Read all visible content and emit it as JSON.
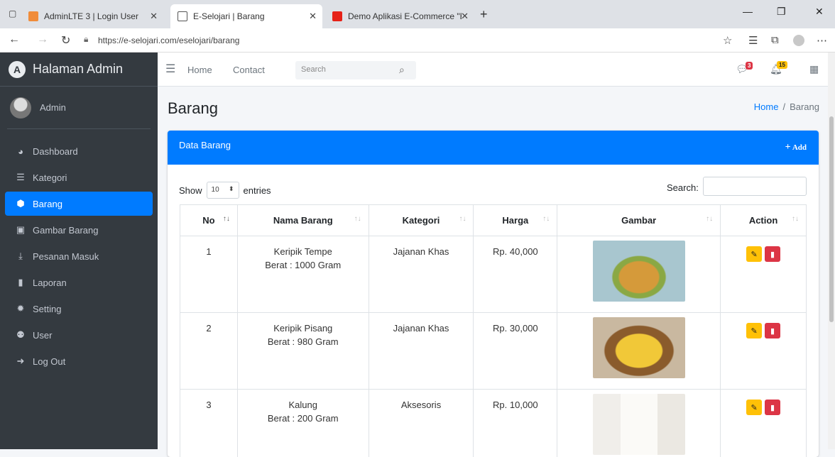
{
  "browser": {
    "tabs": [
      {
        "label": "AdminLTE 3 | Login User"
      },
      {
        "label": "E-Selojari | Barang"
      },
      {
        "label": "Demo Aplikasi E-Commerce \"E-S"
      }
    ],
    "url": "https://e-selojari.com/eselojari/barang"
  },
  "sidebar": {
    "brand": "Halaman Admin",
    "user": "Admin",
    "items": [
      {
        "label": "Dashboard",
        "icon": "dashboard-icon"
      },
      {
        "label": "Kategori",
        "icon": "list-icon"
      },
      {
        "label": "Barang",
        "icon": "cubes-icon",
        "active": true
      },
      {
        "label": "Gambar Barang",
        "icon": "image-icon"
      },
      {
        "label": "Pesanan Masuk",
        "icon": "download-icon"
      },
      {
        "label": "Laporan",
        "icon": "file-icon"
      },
      {
        "label": "Setting",
        "icon": "cog-icon"
      },
      {
        "label": "User",
        "icon": "users-icon"
      },
      {
        "label": "Log Out",
        "icon": "sign-out-icon"
      }
    ]
  },
  "navbar": {
    "home": "Home",
    "contact": "Contact",
    "search_placeholder": "Search",
    "messages_count": "3",
    "notifications_count": "15"
  },
  "page": {
    "title": "Barang",
    "breadcrumb_home": "Home",
    "breadcrumb_current": "Barang"
  },
  "card": {
    "title": "Data Barang",
    "add_label": "Add",
    "show_label": "Show",
    "entries_value": "10",
    "entries_label": "entries",
    "search_label": "Search:"
  },
  "table": {
    "headers": [
      "No",
      "Nama Barang",
      "Kategori",
      "Harga",
      "Gambar",
      "Action"
    ],
    "rows": [
      {
        "no": "1",
        "nama": "Keripik Tempe",
        "berat": "Berat : 1000 Gram",
        "kategori": "Jajanan Khas",
        "harga": "Rp. 40,000"
      },
      {
        "no": "2",
        "nama": "Keripik Pisang",
        "berat": "Berat : 980 Gram",
        "kategori": "Jajanan Khas",
        "harga": "Rp. 30,000"
      },
      {
        "no": "3",
        "nama": "Kalung",
        "berat": "Berat : 200 Gram",
        "kategori": "Aksesoris",
        "harga": "Rp. 10,000"
      }
    ]
  },
  "colors": {
    "primary": "#007bff",
    "sidebar_bg": "#343a40",
    "edit_btn": "#ffc107",
    "delete_btn": "#dc3545"
  }
}
